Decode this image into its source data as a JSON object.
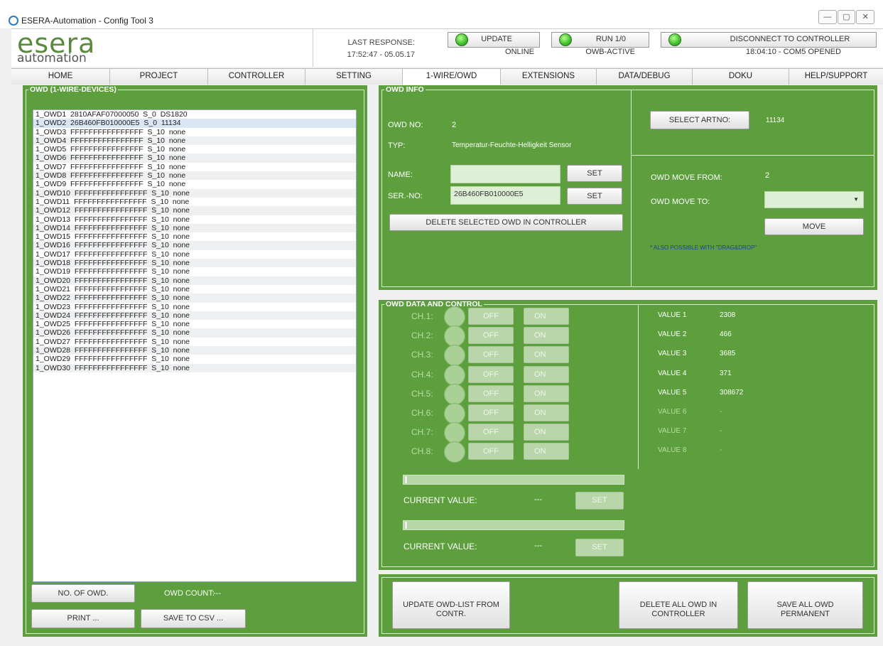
{
  "window": {
    "title": "ESERA-Automation - Config Tool 3",
    "controls": [
      "—",
      "▢",
      "✕"
    ]
  },
  "logo": {
    "main": "esera",
    "sub": "automation"
  },
  "status": {
    "last_response_label": "LAST RESPONSE:",
    "last_response_time": "17:52:47 - 05.05.17",
    "update_label": "UPDATE",
    "update_state": "ONLINE",
    "run_label": "RUN 1/0",
    "run_state": "OWB-ACTIVE",
    "disconnect_label": "DISCONNECT TO CONTROLLER",
    "disconnect_state": "18:04:10 - COM5 OPENED"
  },
  "tabs": [
    "HOME",
    "PROJECT",
    "CONTROLLER",
    "SETTING",
    "1-WIRE/OWD",
    "EXTENSIONS",
    "DATA/DEBUG",
    "DOKU",
    "HELP/SUPPORT"
  ],
  "owd_list": {
    "legend": "OWD (1-WIRE-DEVICES)",
    "items": [
      "1_OWD1  2810AFAF07000050  S_0  DS1820",
      "1_OWD2  26B460FB010000E5  S_0  11134",
      "1_OWD3  FFFFFFFFFFFFFFFF  S_10  none",
      "1_OWD4  FFFFFFFFFFFFFFFF  S_10  none",
      "1_OWD5  FFFFFFFFFFFFFFFF  S_10  none",
      "1_OWD6  FFFFFFFFFFFFFFFF  S_10  none",
      "1_OWD7  FFFFFFFFFFFFFFFF  S_10  none",
      "1_OWD8  FFFFFFFFFFFFFFFF  S_10  none",
      "1_OWD9  FFFFFFFFFFFFFFFF  S_10  none",
      "1_OWD10  FFFFFFFFFFFFFFFF  S_10  none",
      "1_OWD11  FFFFFFFFFFFFFFFF  S_10  none",
      "1_OWD12  FFFFFFFFFFFFFFFF  S_10  none",
      "1_OWD13  FFFFFFFFFFFFFFFF  S_10  none",
      "1_OWD14  FFFFFFFFFFFFFFFF  S_10  none",
      "1_OWD15  FFFFFFFFFFFFFFFF  S_10  none",
      "1_OWD16  FFFFFFFFFFFFFFFF  S_10  none",
      "1_OWD17  FFFFFFFFFFFFFFFF  S_10  none",
      "1_OWD18  FFFFFFFFFFFFFFFF  S_10  none",
      "1_OWD19  FFFFFFFFFFFFFFFF  S_10  none",
      "1_OWD20  FFFFFFFFFFFFFFFF  S_10  none",
      "1_OWD21  FFFFFFFFFFFFFFFF  S_10  none",
      "1_OWD22  FFFFFFFFFFFFFFFF  S_10  none",
      "1_OWD23  FFFFFFFFFFFFFFFF  S_10  none",
      "1_OWD24  FFFFFFFFFFFFFFFF  S_10  none",
      "1_OWD25  FFFFFFFFFFFFFFFF  S_10  none",
      "1_OWD26  FFFFFFFFFFFFFFFF  S_10  none",
      "1_OWD27  FFFFFFFFFFFFFFFF  S_10  none",
      "1_OWD28  FFFFFFFFFFFFFFFF  S_10  none",
      "1_OWD29  FFFFFFFFFFFFFFFF  S_10  none",
      "1_OWD30  FFFFFFFFFFFFFFFF  S_10  none"
    ],
    "selected_index": 1,
    "no_of_owd_button": "NO. OF OWD.",
    "owd_count_label": "OWD COUNT:",
    "owd_count_value": "---",
    "print_button": "PRINT ...",
    "save_csv_button": "SAVE TO CSV ..."
  },
  "owd_info": {
    "legend": "OWD INFO",
    "owd_no_label": "OWD NO:",
    "owd_no_value": "2",
    "typ_label": "TYP:",
    "typ_value": "Temperatur-Feuchte-Helligkeit Sensor",
    "name_label": "NAME:",
    "name_value": "",
    "set_label": "SET",
    "serno_label": "SER.-NO:",
    "serno_value": "26B460FB010000E5",
    "delete_button": "DELETE SELECTED OWD IN CONTROLLER",
    "select_artno_button": "SELECT ARTNO:",
    "artno_value": "11134",
    "move_from_label": "OWD MOVE FROM:",
    "move_from_value": "2",
    "move_to_label": "OWD MOVE TO:",
    "move_to_value": "",
    "move_button": "MOVE",
    "dragdrop_note": "* ALSO POSSIBLE WITH \"DRAG&DROP\""
  },
  "owd_data": {
    "legend": "OWD DATA AND CONTROL",
    "off_label": "OFF",
    "on_label": "ON",
    "channels": [
      "CH.1:",
      "CH.2:",
      "CH.3:",
      "CH.4:",
      "CH.5:",
      "CH.6:",
      "CH.7:",
      "CH.8:"
    ],
    "values": [
      {
        "label": "VALUE 1",
        "value": "2308",
        "active": true
      },
      {
        "label": "VALUE 2",
        "value": "466",
        "active": true
      },
      {
        "label": "VALUE 3",
        "value": "3685",
        "active": true
      },
      {
        "label": "VALUE 4",
        "value": "371",
        "active": true
      },
      {
        "label": "VALUE 5",
        "value": "308672",
        "active": true
      },
      {
        "label": "VALUE 6",
        "value": "-",
        "active": false
      },
      {
        "label": "VALUE 7",
        "value": "-",
        "active": false
      },
      {
        "label": "VALUE 8",
        "value": "-",
        "active": false
      }
    ],
    "current_value_label": "CURRENT VALUE:",
    "current_value_1": "---",
    "current_value_2": "---",
    "set_label": "SET"
  },
  "bottom_actions": {
    "update_list": "UPDATE OWD-LIST FROM\nCONTR.",
    "delete_all": "DELETE ALL OWD IN\nCONTROLLER",
    "save_all": "SAVE ALL OWD\nPERMANENT"
  },
  "colors": {
    "panel_green": "#5c9f3c",
    "led_green": "#3fbe2a",
    "logo_green": "#5a8a3c",
    "note_blue": "#1d3fa8"
  }
}
